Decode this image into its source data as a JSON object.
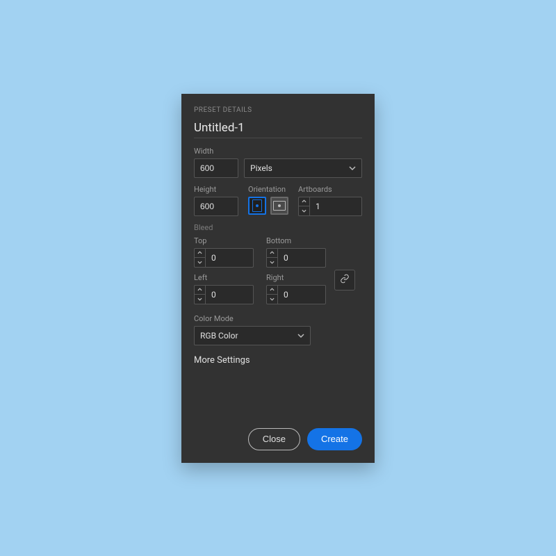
{
  "header": {
    "label": "PRESET DETAILS"
  },
  "title": "Untitled-1",
  "labels": {
    "width": "Width",
    "height": "Height",
    "orientation": "Orientation",
    "artboards": "Artboards",
    "bleed": "Bleed",
    "top": "Top",
    "bottom": "Bottom",
    "left": "Left",
    "right": "Right",
    "colorMode": "Color Mode"
  },
  "values": {
    "width": "600",
    "height": "600",
    "units": "Pixels",
    "artboards": "1",
    "bleedTop": "0",
    "bleedBottom": "0",
    "bleedLeft": "0",
    "bleedRight": "0",
    "colorMode": "RGB Color"
  },
  "moreSettings": "More Settings",
  "buttons": {
    "close": "Close",
    "create": "Create"
  },
  "colors": {
    "accent": "#1473e6"
  }
}
